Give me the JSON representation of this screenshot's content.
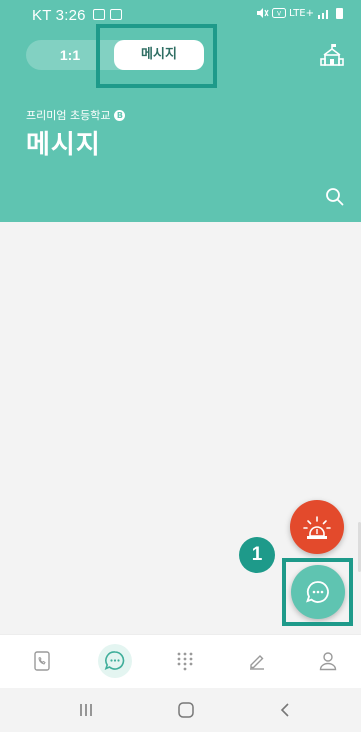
{
  "status_bar": {
    "time": "KT 3:26",
    "network": "LTE+"
  },
  "header": {
    "tabs": [
      {
        "label": "1:1",
        "selected": false
      },
      {
        "label": "메시지",
        "selected": true
      }
    ],
    "school_name": "프리미엄 초등학교",
    "school_badge": "B",
    "title": "메시지"
  },
  "annotation": {
    "step_number": "1"
  },
  "colors": {
    "primary": "#5fc4b1",
    "highlight": "#1e9a8a",
    "alarm": "#e34a2c"
  },
  "bottom_nav": {
    "items": [
      {
        "icon": "phone-book-icon",
        "active": false
      },
      {
        "icon": "chat-icon",
        "active": true
      },
      {
        "icon": "dialpad-icon",
        "active": false
      },
      {
        "icon": "pencil-icon",
        "active": false
      },
      {
        "icon": "person-icon",
        "active": false
      }
    ]
  },
  "system_nav": [
    "recents-button",
    "home-button",
    "back-button"
  ]
}
